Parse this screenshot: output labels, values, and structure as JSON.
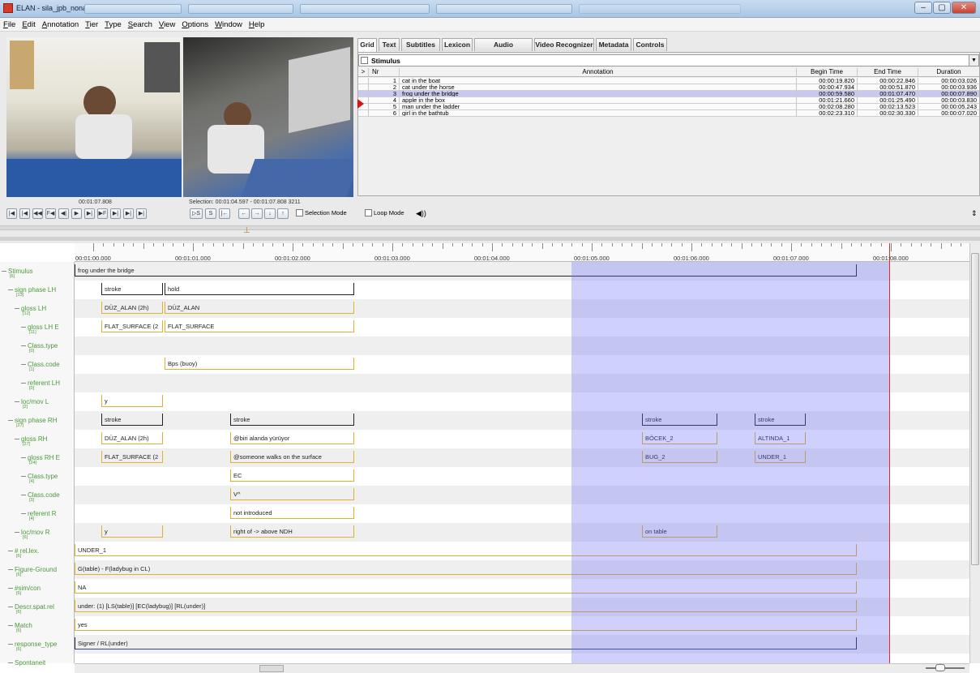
{
  "window": {
    "title": "ELAN - sila_jpb_nonang.eaf",
    "buttons": [
      "–",
      "▢",
      "✕"
    ]
  },
  "menu": [
    "File",
    "Edit",
    "Annotation",
    "Tier",
    "Type",
    "Search",
    "View",
    "Options",
    "Window",
    "Help"
  ],
  "tabs": [
    "Grid",
    "Text",
    "Subtitles",
    "Lexicon",
    "Audio Recognizer",
    "Video Recognizer",
    "Metadata",
    "Controls"
  ],
  "grid": {
    "tier": "Stimulus",
    "columns": [
      ">",
      "Nr",
      "Annotation",
      "Begin Time",
      "End Time",
      "Duration"
    ],
    "rows": [
      {
        "nr": "1",
        "annotation": "cat in the boat",
        "begin": "00:00:19.820",
        "end": "00:00:22.846",
        "duration": "00:00:03.026"
      },
      {
        "nr": "2",
        "annotation": "cat under the horse",
        "begin": "00:00:47.934",
        "end": "00:00:51.870",
        "duration": "00:00:03.936"
      },
      {
        "nr": "3",
        "annotation": "frog under the bridge",
        "begin": "00:00:59.580",
        "end": "00:01:07.470",
        "duration": "00:00:07.890"
      },
      {
        "nr": "4",
        "annotation": "apple in the box",
        "begin": "00:01:21.660",
        "end": "00:01:25.490",
        "duration": "00:00:03.830"
      },
      {
        "nr": "5",
        "annotation": "man under the ladder",
        "begin": "00:02:08.280",
        "end": "00:02:13.523",
        "duration": "00:00:05.243"
      },
      {
        "nr": "6",
        "annotation": "girl in the bathtub",
        "begin": "00:02:23.310",
        "end": "00:02:30.330",
        "duration": "00:00:07.020"
      }
    ]
  },
  "player": {
    "time": "00:01:07.808",
    "selection": "Selection: 00:01:04.597 - 00:01:07.808  3211",
    "selection_mode": "Selection Mode",
    "loop_mode": "Loop Mode",
    "buttons": [
      "|◀",
      "|◀",
      "◀◀",
      "F◀",
      "◀|",
      "▶",
      "▶|",
      "▶F",
      "▶|",
      "▶|",
      "▶|",
      "▷S",
      "S",
      "|←",
      "←",
      "→",
      "↓",
      "↑"
    ]
  },
  "ruler": {
    "labels": [
      "00:01:00.000",
      "00:01:01.000",
      "00:01:02.000",
      "00:01:03.000",
      "00:01:04.000",
      "00:01:05.000",
      "00:01:06.000",
      "00:01:07.000",
      "00:01:08.000"
    ]
  },
  "tiers": [
    {
      "name": "Stimulus",
      "count": "[6]"
    },
    {
      "name": "sign phase LH",
      "count": "[13]"
    },
    {
      "name": "gloss LH",
      "count": "[12]"
    },
    {
      "name": "gloss LH E",
      "count": "[11]"
    },
    {
      "name": "Class.type",
      "count": "[0]"
    },
    {
      "name": "Class.code",
      "count": "[1]"
    },
    {
      "name": "referent LH",
      "count": "[0]"
    },
    {
      "name": "loc/mov L",
      "count": "[2]"
    },
    {
      "name": "sign phase RH",
      "count": "[27]"
    },
    {
      "name": "gloss RH",
      "count": "[27]"
    },
    {
      "name": "gloss RH E",
      "count": "[24]"
    },
    {
      "name": "Class.type",
      "count": "[4]"
    },
    {
      "name": "Class.code",
      "count": "[3]"
    },
    {
      "name": "referent R",
      "count": "[4]"
    },
    {
      "name": "loc/mov R",
      "count": "[6]"
    },
    {
      "name": "# rel.lex.",
      "count": "[6]"
    },
    {
      "name": "Figure-Ground",
      "count": "[6]"
    },
    {
      "name": "#sim/con",
      "count": "[6]"
    },
    {
      "name": "Descr.spat.rel",
      "count": "[6]"
    },
    {
      "name": "Match",
      "count": "[6]"
    },
    {
      "name": "response_type",
      "count": "[6]"
    },
    {
      "name": "Spontaneit",
      "count": ""
    }
  ],
  "annotations": {
    "stimulus": "frog under the bridge",
    "lh_phase": [
      "stroke",
      "hold"
    ],
    "lh_gloss": [
      "DÜZ_ALAN (2h)",
      "DÜZ_ALAN"
    ],
    "lh_gloss_e": [
      "FLAT_SURFACE (2",
      "FLAT_SURFACE"
    ],
    "lh_class_code": "Bps (buoy)",
    "lh_locmov": "y",
    "rh_phase": [
      "stroke",
      "stroke",
      "stroke",
      "stroke"
    ],
    "rh_gloss": [
      "DÜZ_ALAN (2h)",
      "@biri alanda yürüyor",
      "BÖCEK_2",
      "ALTINDA_1"
    ],
    "rh_gloss_e": [
      "FLAT_SURFACE (2",
      "@someone walks on the surface",
      "BUG_2",
      "UNDER_1"
    ],
    "rh_class_type": "EC",
    "rh_class_code": "V^",
    "rh_referent": "not introduced",
    "rh_locmov": [
      "y",
      "right of -> above NDH",
      "on table"
    ],
    "rel_lex": "UNDER_1",
    "figure_ground": "G(table) - F(ladybug in CL)",
    "sim_con": "NA",
    "descr_spat": "under: (1) [LS(table)] [EC(ladybug)] [RL(under)]",
    "match": "yes",
    "response_type": "Signer / RL(under)"
  }
}
